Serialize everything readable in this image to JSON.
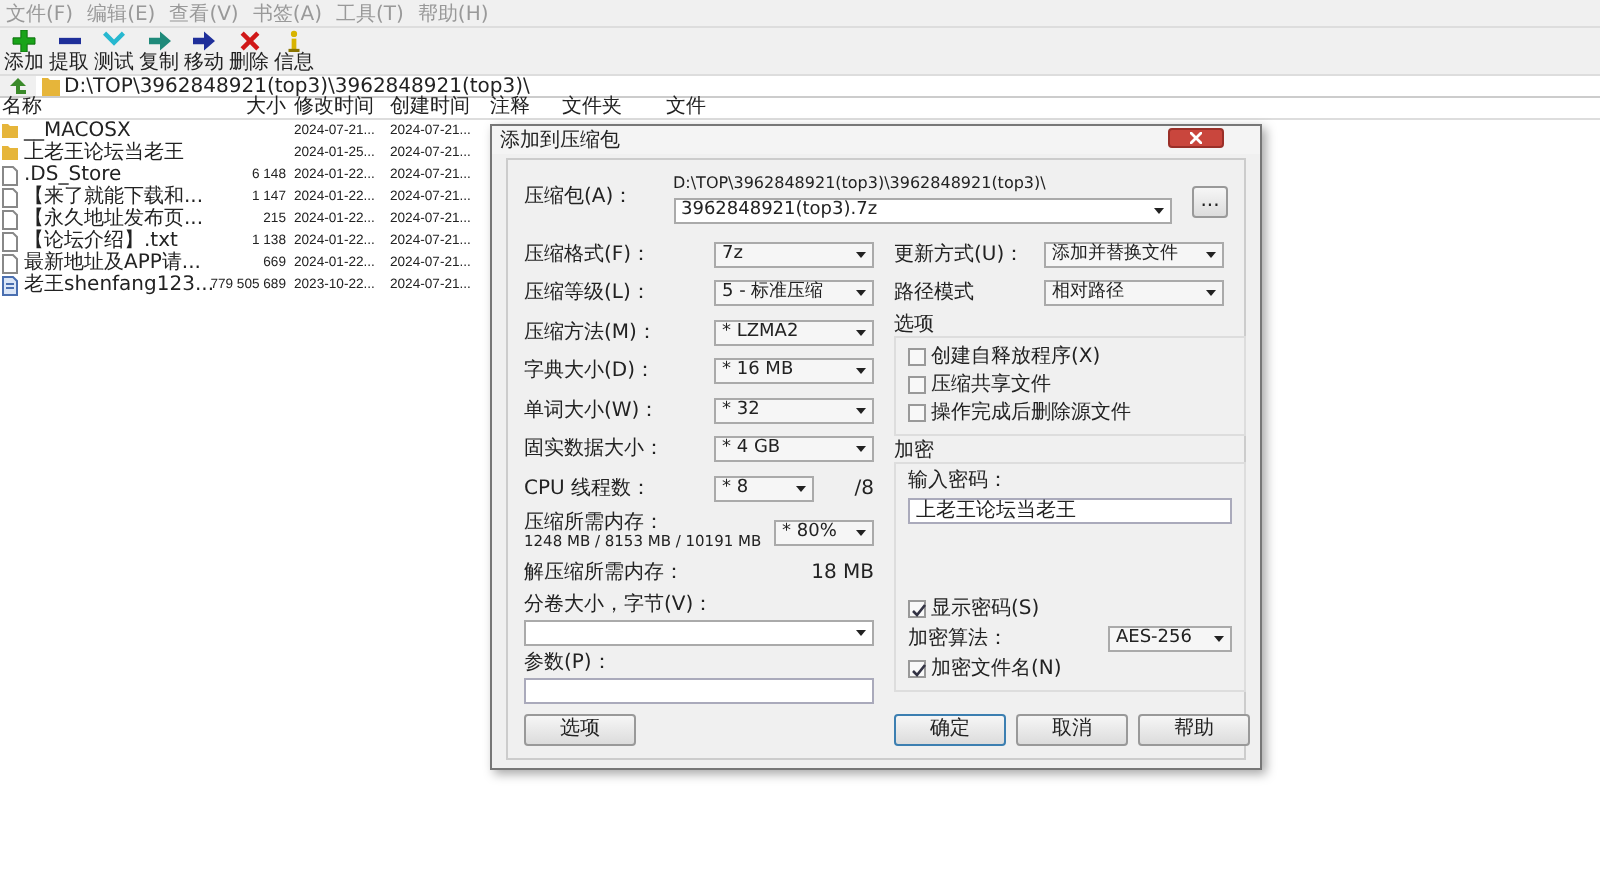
{
  "menu": [
    "文件(F)",
    "编辑(E)",
    "查看(V)",
    "书签(A)",
    "工具(T)",
    "帮助(H)"
  ],
  "toolbar": [
    {
      "kind": "add",
      "label": "添加"
    },
    {
      "kind": "extract",
      "label": "提取"
    },
    {
      "kind": "test",
      "label": "测试"
    },
    {
      "kind": "copy",
      "label": "复制"
    },
    {
      "kind": "move",
      "label": "移动"
    },
    {
      "kind": "delete",
      "label": "删除"
    },
    {
      "kind": "info",
      "label": "信息"
    }
  ],
  "address": {
    "path": "D:\\TOP\\3962848921(top3)\\3962848921(top3)\\"
  },
  "file_list": {
    "columns": [
      "名称",
      "大小",
      "修改时间",
      "创建时间",
      "注释",
      "文件夹",
      "文件"
    ],
    "rows": [
      {
        "kind": "folder",
        "name": "__MACOSX",
        "modified": "2024-07-21...",
        "created": "2024-07-21..."
      },
      {
        "kind": "folder",
        "name": "上老王论坛当老王",
        "modified": "2024-01-25...",
        "created": "2024-07-21..."
      },
      {
        "kind": "file",
        "name": ".DS_Store",
        "size": "6 148",
        "modified": "2024-01-22...",
        "created": "2024-07-21..."
      },
      {
        "kind": "file",
        "name": "【来了就能下载和...",
        "size": "1 147",
        "modified": "2024-01-22...",
        "created": "2024-07-21..."
      },
      {
        "kind": "file",
        "name": "【永久地址发布页...",
        "size": "215",
        "modified": "2024-01-22...",
        "created": "2024-07-21..."
      },
      {
        "kind": "file",
        "name": "【论坛介绍】.txt",
        "size": "1 138",
        "modified": "2024-01-22...",
        "created": "2024-07-21..."
      },
      {
        "kind": "file",
        "name": "最新地址及APP请...",
        "size": "669",
        "modified": "2024-01-22...",
        "created": "2024-07-21..."
      },
      {
        "kind": "document",
        "name": "老王shenfang123...",
        "size": "779 505 689",
        "modified": "2023-10-22...",
        "created": "2024-07-21..."
      }
    ]
  },
  "dialog": {
    "title": "添加到压缩包",
    "archive": {
      "label": "压缩包(A)：",
      "folder": "D:\\TOP\\3962848921(top3)\\3962848921(top3)\\",
      "name": "3962848921(top3).7z",
      "browse": "..."
    },
    "left": [
      {
        "kind": "select",
        "label": "压缩格式(F)：",
        "value": "7z"
      },
      {
        "kind": "select",
        "label": "压缩等级(L)：",
        "value": "5 - 标准压缩"
      },
      {
        "kind": "select",
        "label": "压缩方法(M)：",
        "value": "* LZMA2"
      },
      {
        "kind": "select",
        "label": "字典大小(D)：",
        "value": "* 16 MB"
      },
      {
        "kind": "select",
        "label": "单词大小(W)：",
        "value": "* 32"
      },
      {
        "kind": "select",
        "label": "固实数据大小：",
        "value": "* 4 GB"
      },
      {
        "kind": "threads",
        "label": "CPU 线程数：",
        "value": "* 8",
        "total": "/8"
      },
      {
        "kind": "memory",
        "label": "压缩所需内存：",
        "detail": "1248 MB / 8153 MB / 10191 MB",
        "value": "* 80%"
      },
      {
        "kind": "info",
        "label": "解压缩所需内存：",
        "value": "18 MB"
      },
      {
        "kind": "combo",
        "label": "分卷大小，字节(V)："
      },
      {
        "kind": "field",
        "label": "参数(P)："
      },
      {
        "kind": "button",
        "label": "选项"
      }
    ],
    "update_mode": {
      "label": "更新方式(U)：",
      "value": "添加并替换文件"
    },
    "path_mode": {
      "label": "路径模式",
      "value": "相对路径"
    },
    "options": {
      "title": "选项",
      "items": [
        {
          "label": "创建自释放程序(X)",
          "checked": false
        },
        {
          "label": "压缩共享文件",
          "checked": false
        },
        {
          "label": "操作完成后删除源文件",
          "checked": false
        }
      ]
    },
    "encryption": {
      "title": "加密",
      "password_label": "输入密码：",
      "password": "上老王论坛当老王",
      "show_password": {
        "label": "显示密码(S)",
        "checked": true
      },
      "method_label": "加密算法：",
      "method": "AES-256",
      "encrypt_names": {
        "label": "加密文件名(N)",
        "checked": true
      }
    },
    "buttons": [
      {
        "label": "确定",
        "default": true
      },
      {
        "label": "取消",
        "default": false
      },
      {
        "label": "帮助",
        "default": false
      }
    ]
  }
}
